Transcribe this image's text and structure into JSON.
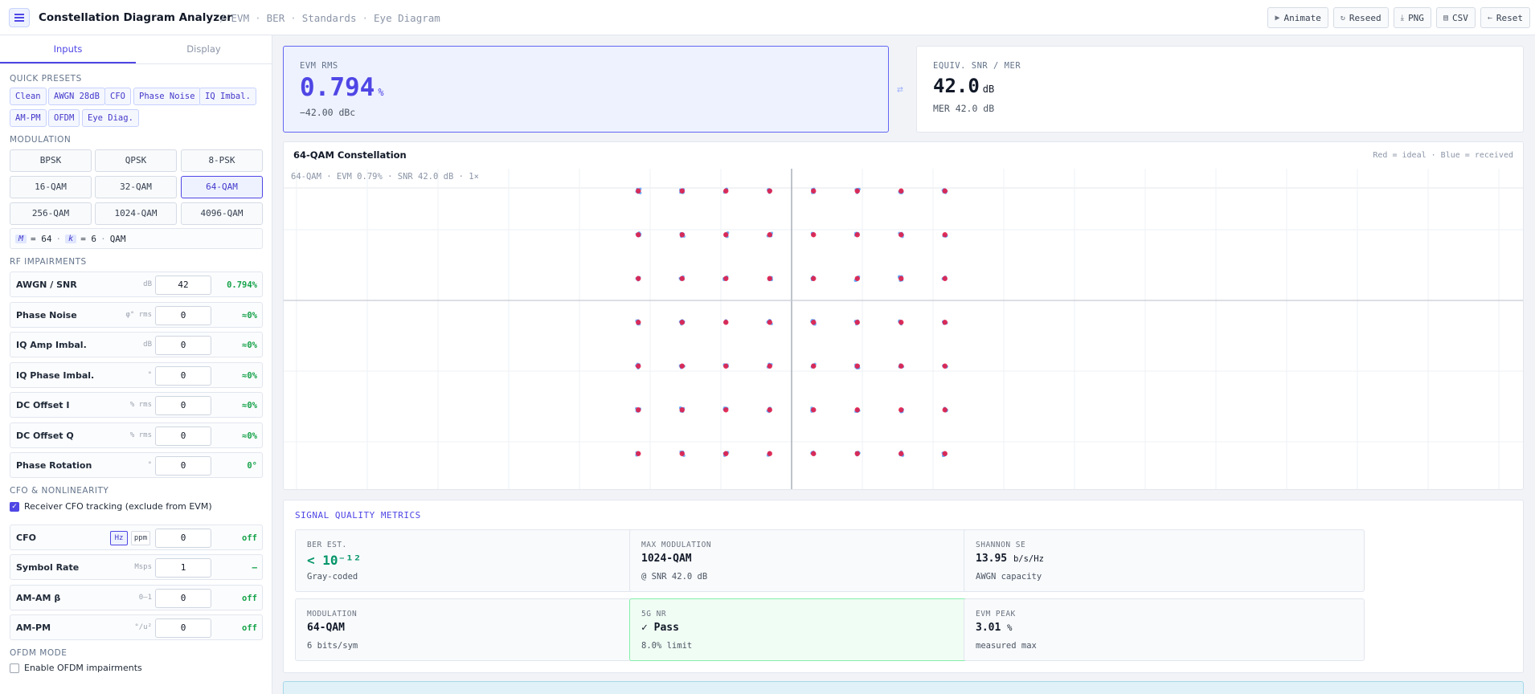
{
  "header": {
    "title": "Constellation Diagram Analyzer",
    "crumbs": [
      "EVM",
      "BER",
      "Standards",
      "Eye Diagram"
    ],
    "buttons": {
      "animate": "Animate",
      "reseed": "Reseed",
      "png": "PNG",
      "csv": "CSV",
      "reset": "Reset"
    }
  },
  "sidebar": {
    "tabs": [
      "Inputs",
      "Display"
    ],
    "presets_title": "QUICK PRESETS",
    "presets": [
      "Clean",
      "AWGN 28dB",
      "CFO",
      "Phase Noise",
      "IQ Imbal.",
      "AM-PM",
      "OFDM",
      "Eye Diag."
    ],
    "modulation_title": "MODULATION",
    "modulations": [
      "BPSK",
      "QPSK",
      "8-PSK",
      "16-QAM",
      "32-QAM",
      "64-QAM",
      "256-QAM",
      "1024-QAM",
      "4096-QAM"
    ],
    "selected_modulation": "64-QAM",
    "mk": {
      "m_label": "M",
      "m_eq": "= 64",
      "k_label": "k",
      "k_eq": "= 6",
      "family": "QAM"
    },
    "rf_title": "RF IMPAIRMENTS",
    "rf": [
      {
        "label": "AWGN / SNR",
        "unit": "dB",
        "value": "42",
        "result": "0.794%"
      },
      {
        "label": "Phase Noise",
        "unit": "φ° rms",
        "value": "0",
        "result": "≈0%"
      },
      {
        "label": "IQ Amp Imbal.",
        "unit": "dB",
        "value": "0",
        "result": "≈0%"
      },
      {
        "label": "IQ Phase Imbal.",
        "unit": "°",
        "value": "0",
        "result": "≈0%"
      },
      {
        "label": "DC Offset I",
        "unit": "% rms",
        "value": "0",
        "result": "≈0%"
      },
      {
        "label": "DC Offset Q",
        "unit": "% rms",
        "value": "0",
        "result": "≈0%"
      },
      {
        "label": "Phase Rotation",
        "unit": "°",
        "value": "0",
        "result": "0°"
      }
    ],
    "cfo_title": "CFO & NONLINEARITY",
    "cfo_tracking": "Receiver CFO tracking (exclude from EVM)",
    "cfo": {
      "label": "CFO",
      "unit_hz": "Hz",
      "unit_ppm": "ppm",
      "value": "0",
      "result": "off"
    },
    "nonlin": [
      {
        "label": "Symbol Rate",
        "unit": "Msps",
        "value": "1",
        "result": "—"
      },
      {
        "label": "AM-AM β",
        "unit": "0–1",
        "value": "0",
        "result": "off"
      },
      {
        "label": "AM-PM",
        "unit": "°/u²",
        "value": "0",
        "result": "off"
      }
    ],
    "ofdm_title": "OFDM MODE",
    "ofdm_enable": "Enable OFDM impairments"
  },
  "kpi": {
    "evm_label": "EVM RMS",
    "evm_value": "0.794",
    "evm_unit": "%",
    "evm_sub": "−42.00 dBc",
    "snr_label": "EQUIV. SNR / MER",
    "snr_value": "42.0",
    "snr_unit": "dB",
    "snr_sub": "MER 42.0 dB"
  },
  "constellation": {
    "title": "64-QAM Constellation",
    "legend": "Red = ideal · Blue = received",
    "info": "64-QAM  ·  EVM 0.79%  ·  SNR 42.0 dB  ·  1×",
    "colors": {
      "ideal": "#e11d48",
      "received": "#60a5fa"
    }
  },
  "metrics": {
    "title": "SIGNAL QUALITY METRICS",
    "cards": [
      {
        "label": "BER EST.",
        "value": "< 10⁻¹²",
        "unit": "",
        "sub": "Gray-coded"
      },
      {
        "label": "MAX MODULATION",
        "value": "1024-QAM",
        "unit": "",
        "sub": "@ SNR 42.0 dB"
      },
      {
        "label": "SHANNON SE",
        "value": "13.95",
        "unit": "b/s/Hz",
        "sub": "AWGN capacity"
      },
      {
        "label": "MODULATION",
        "value": "64-QAM",
        "unit": "",
        "sub": "6 bits/sym"
      },
      {
        "label": "5G NR",
        "value": "✓ Pass",
        "unit": "",
        "sub": "8.0% limit"
      },
      {
        "label": "EVM PEAK",
        "value": "3.01",
        "unit": "%",
        "sub": "measured max"
      }
    ]
  }
}
